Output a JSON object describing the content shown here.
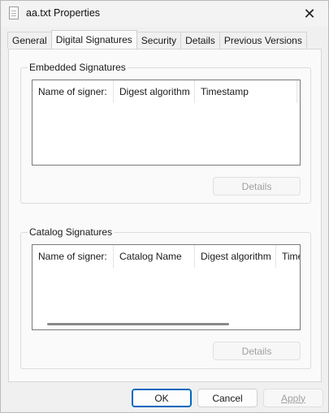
{
  "window": {
    "title": "aa.txt Properties",
    "icon": "text-file-icon",
    "close_glyph": "✕"
  },
  "tabs": [
    {
      "label": "General",
      "active": false
    },
    {
      "label": "Digital Signatures",
      "active": true
    },
    {
      "label": "Security",
      "active": false
    },
    {
      "label": "Details",
      "active": false
    },
    {
      "label": "Previous Versions",
      "active": false
    }
  ],
  "embedded": {
    "title": "Embedded Signatures",
    "columns": [
      "Name of signer:",
      "Digest algorithm",
      "Timestamp"
    ],
    "details_label": "Details"
  },
  "catalog": {
    "title": "Catalog Signatures",
    "columns": [
      "Name of signer:",
      "Catalog Name",
      "Digest algorithm",
      "Time"
    ],
    "details_label": "Details"
  },
  "footer": {
    "ok_label": "OK",
    "cancel_label": "Cancel",
    "apply_label": "Apply"
  }
}
